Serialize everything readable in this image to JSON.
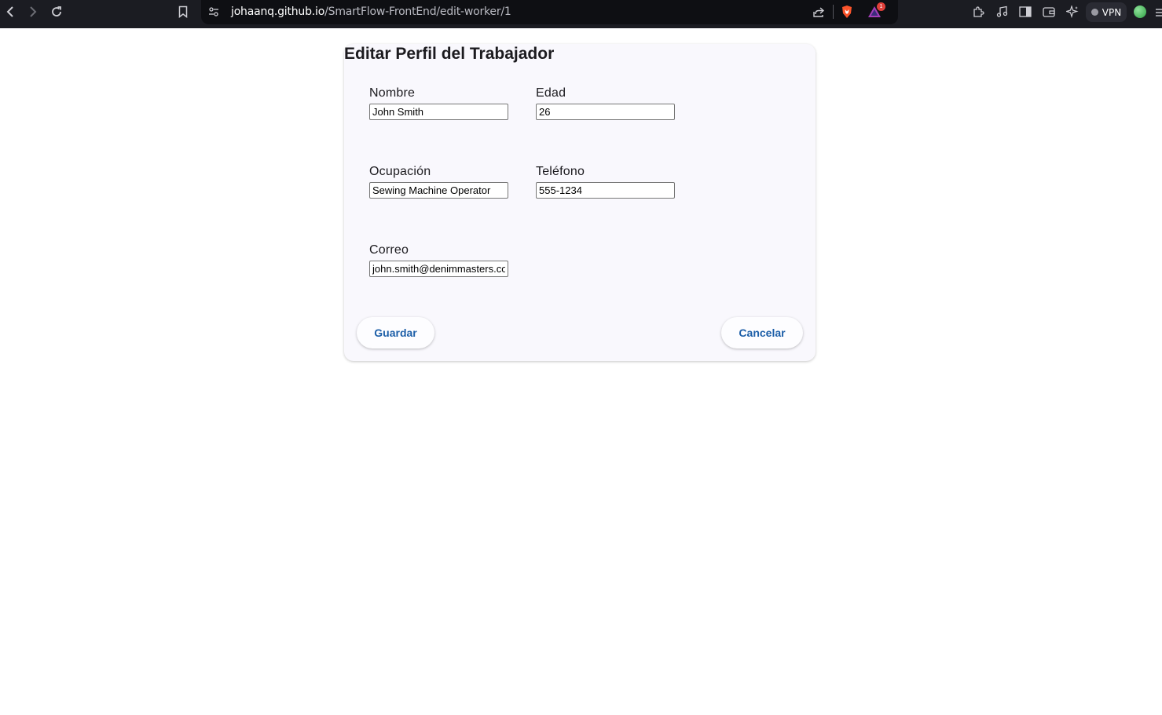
{
  "browser": {
    "url_host": "johaanq.github.io",
    "url_path": "/SmartFlow-FrontEnd/edit-worker/1",
    "vpn_label": "VPN",
    "notification_count": "1",
    "icons": [
      "back-icon",
      "forward-icon",
      "reload-icon",
      "bookmark-icon",
      "site-settings-icon",
      "share-icon",
      "brave-shield-icon",
      "brave-rewards-icon",
      "extensions-icon",
      "media-icon",
      "sidebar-icon",
      "wallet-icon",
      "leo-ai-icon",
      "menu-icon"
    ]
  },
  "form": {
    "title": "Editar Perfil del Trabajador",
    "fields": {
      "nombre": {
        "label": "Nombre",
        "value": "John Smith"
      },
      "edad": {
        "label": "Edad",
        "value": "26"
      },
      "ocupacion": {
        "label": "Ocupación",
        "value": "Sewing Machine Operator"
      },
      "telefono": {
        "label": "Teléfono",
        "value": "555-1234"
      },
      "correo": {
        "label": "Correo",
        "value": "john.smith@denimmasters.com"
      }
    },
    "save_label": "Guardar",
    "cancel_label": "Cancelar"
  },
  "colors": {
    "accent": "#1d5fa8",
    "card_background": "#f9f8fd",
    "toolbar_background": "#1b1c22"
  }
}
